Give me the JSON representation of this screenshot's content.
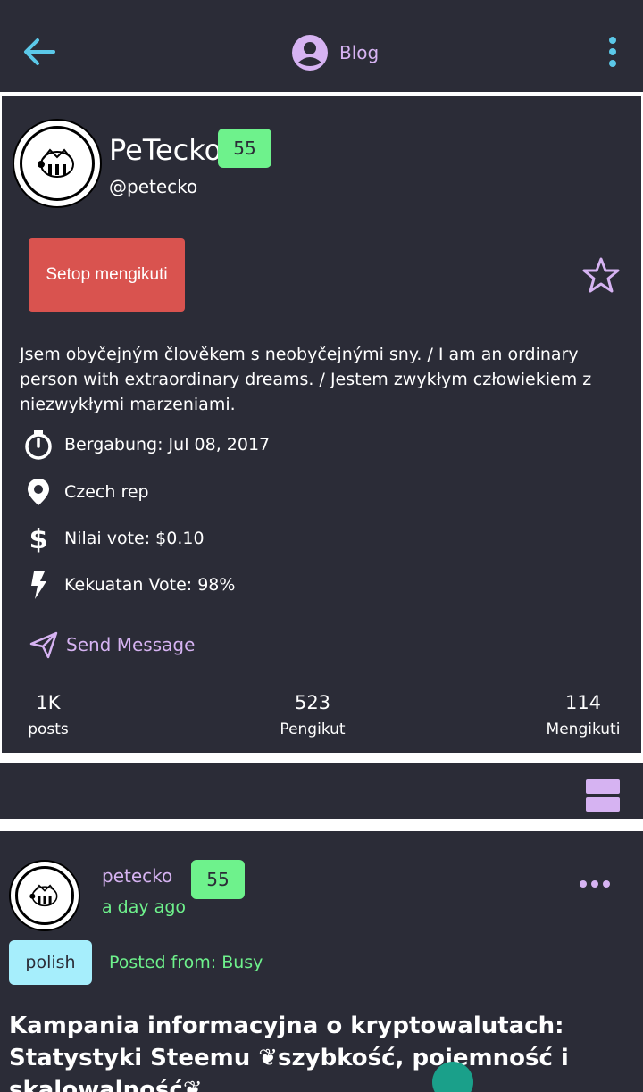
{
  "header": {
    "title": "Blog",
    "icons": {
      "back": "arrow-left-icon",
      "account": "account-circle-icon",
      "more": "more-vertical-icon"
    },
    "accent": "#5bc8e8"
  },
  "profile": {
    "name": "PeTecko",
    "handle": "@petecko",
    "reputation": "55",
    "unfollow_label": "Setop mengikuti",
    "bio": "Jsem obyčejným člověkem s neobyčejnými sny. / I am an ordinary person with extraordinary dreams. / Jestem zwykłym człowiekiem z niezwykłymi marzeniami.",
    "info": {
      "joined": "Bergabung: Jul 08, 2017",
      "location": "Czech rep",
      "vote_value": "Nilai vote: $0.10",
      "voting_power": "Kekuatan Vote: 98%"
    },
    "send_message": "Send Message",
    "stats": {
      "posts_count": "1K",
      "posts_label": "posts",
      "followers_count": "523",
      "followers_label": "Pengikut",
      "following_count": "114",
      "following_label": "Mengikuti"
    }
  },
  "post": {
    "author": "petecko",
    "reputation": "55",
    "time": "a day ago",
    "tag": "polish",
    "posted_from": "Posted from: Busy",
    "title": "Kampania informacyjna o kryptowalutach: Statystyki Steemu ❦szybkość, pojemność i skalowalność❦"
  },
  "colors": {
    "background": "#2b2c37",
    "purple": "#d6b3f2",
    "green": "#6ef28c",
    "red": "#d9534f",
    "cyan": "#a6eefc"
  }
}
